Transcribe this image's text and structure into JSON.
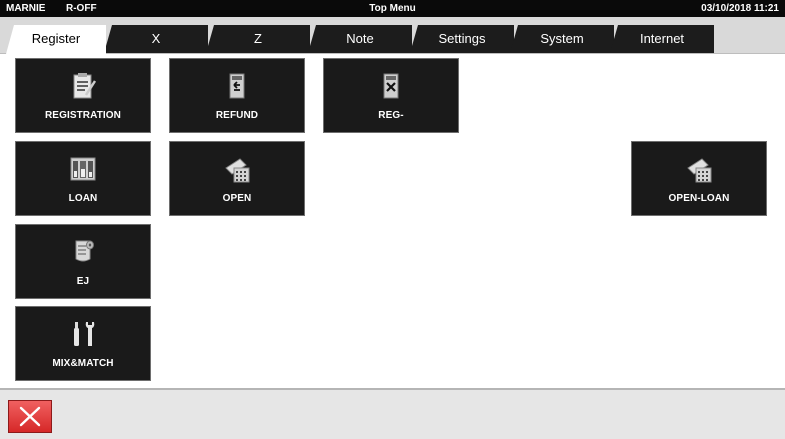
{
  "statusbar": {
    "user": "MARNIE",
    "mode": "R-OFF",
    "title": "Top Menu",
    "datetime": "03/10/2018 11:21"
  },
  "tabs": [
    {
      "label": "Register",
      "active": true
    },
    {
      "label": "X",
      "active": false
    },
    {
      "label": "Z",
      "active": false
    },
    {
      "label": "Note",
      "active": false
    },
    {
      "label": "Settings",
      "active": false
    },
    {
      "label": "System",
      "active": false
    },
    {
      "label": "Internet",
      "active": false
    }
  ],
  "tiles": [
    {
      "label": "REGISTRATION",
      "icon": "registration-clipboard-icon"
    },
    {
      "label": "REFUND",
      "icon": "refund-icon"
    },
    {
      "label": "REG-",
      "icon": "reg-minus-icon"
    },
    {
      "label": "LOAN",
      "icon": "loan-drawer-icon"
    },
    {
      "label": "OPEN",
      "icon": "open-drawer-icon"
    },
    {
      "label": "OPEN-LOAN",
      "icon": "open-loan-drawer-icon"
    },
    {
      "label": "EJ",
      "icon": "journal-roll-icon"
    },
    {
      "label": "MIX&MATCH",
      "icon": "tools-icon"
    }
  ],
  "bottombar": {
    "close_icon": "close-x-icon",
    "close_color": "#e03a3a"
  }
}
